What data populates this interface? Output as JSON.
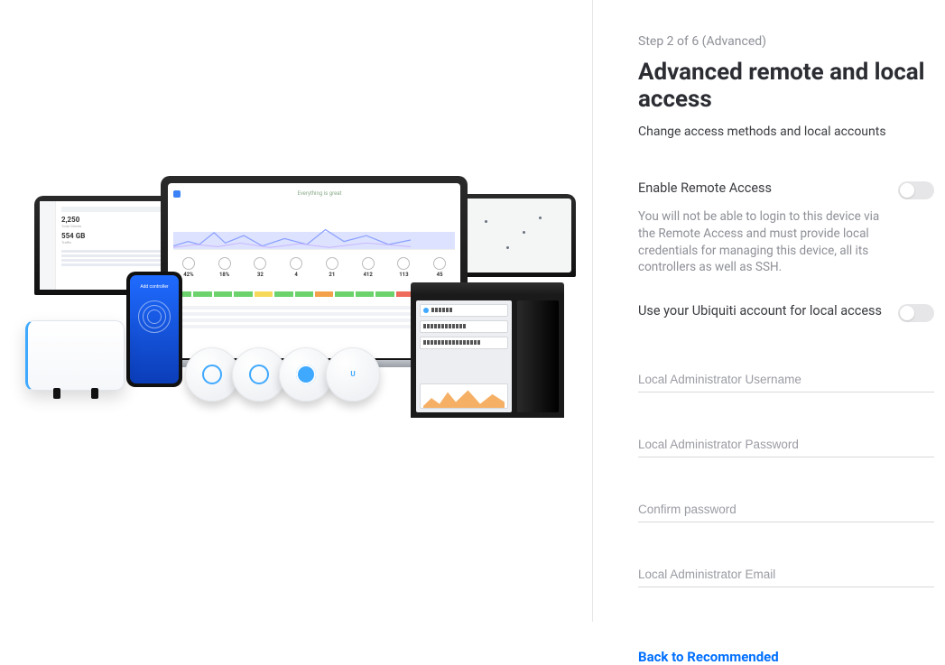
{
  "step_label": "Step 2 of 6 (Advanced)",
  "title": "Advanced remote and local access",
  "subtitle": "Change access methods and local accounts",
  "remote": {
    "label": "Enable Remote Access",
    "help": "You will not be able to login to this device via the Remote Access and must provide local credentials for managing this device, all its controllers as well as SSH."
  },
  "ubiquiti_account": {
    "label": "Use your Ubiquiti account for local access"
  },
  "fields": {
    "username_placeholder": "Local Administrator Username",
    "password_placeholder": "Local Administrator Password",
    "confirm_placeholder": "Confirm password",
    "email_placeholder": "Local Administrator Email"
  },
  "footer_link": "Back to Recommended",
  "illustration": {
    "dash_num1": "2,250",
    "dash_num2": "554 GB",
    "center_tag": "Everything is great",
    "phone_title": "Add controller",
    "metrics": [
      "42%",
      "18%",
      "32",
      "4",
      "21",
      "412",
      "113",
      "45"
    ]
  }
}
